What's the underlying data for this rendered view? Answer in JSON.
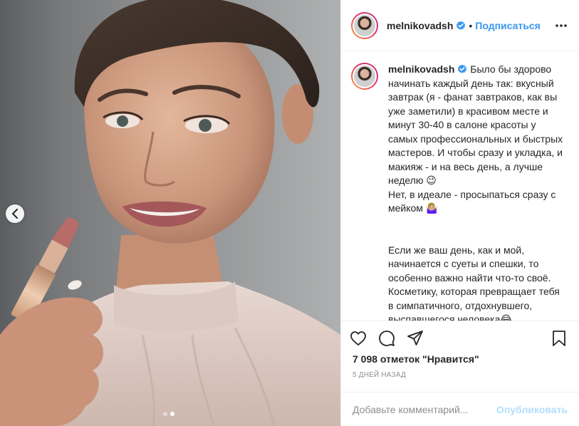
{
  "post": {
    "username": "melnikovadsh",
    "separator": "•",
    "follow_label": "Подписаться",
    "caption": "Было бы здорово начинать каждый день так: вкусный завтрак (я - фанат завтраков, как вы уже заметили) в красивом месте и минут 30-40 в салоне красоты у самых профессиональных и быстрых мастеров. И чтобы сразу и укладка, и макияж - и на весь день, а лучше неделю 😉\nНет, в идеале - просыпаться сразу с мейком 🤷🏼‍♀️\n\n\nЕсли же ваш день, как и мой, начинается с суеты и спешки, то особенно важно найти что-то своё. Косметику, которая превращает тебя в симпатичного, отдохнувшего, выспавшегося человека😂.\nСмотрится естественно и свежо, и всё необходимое (тушь, пудра",
    "likes": "7 098 отметок \"Нравится\"",
    "time": "5 дней назад",
    "comment_placeholder": "Добавьте комментарий...",
    "publish_label": "Опубликовать"
  },
  "carousel": {
    "slide_count": 2,
    "active_slide": 2
  },
  "icons": {
    "verified": "verified-badge-icon",
    "more": "more-options-icon",
    "like": "heart-icon",
    "comment": "comment-bubble-icon",
    "share": "paper-plane-icon",
    "save": "bookmark-icon",
    "prev": "chevron-left-icon"
  },
  "colors": {
    "accent": "#3897f0",
    "verified": "#3897f0",
    "publish_disabled": "#b2dffc",
    "muted": "#8e8e8e",
    "text": "#262626"
  }
}
